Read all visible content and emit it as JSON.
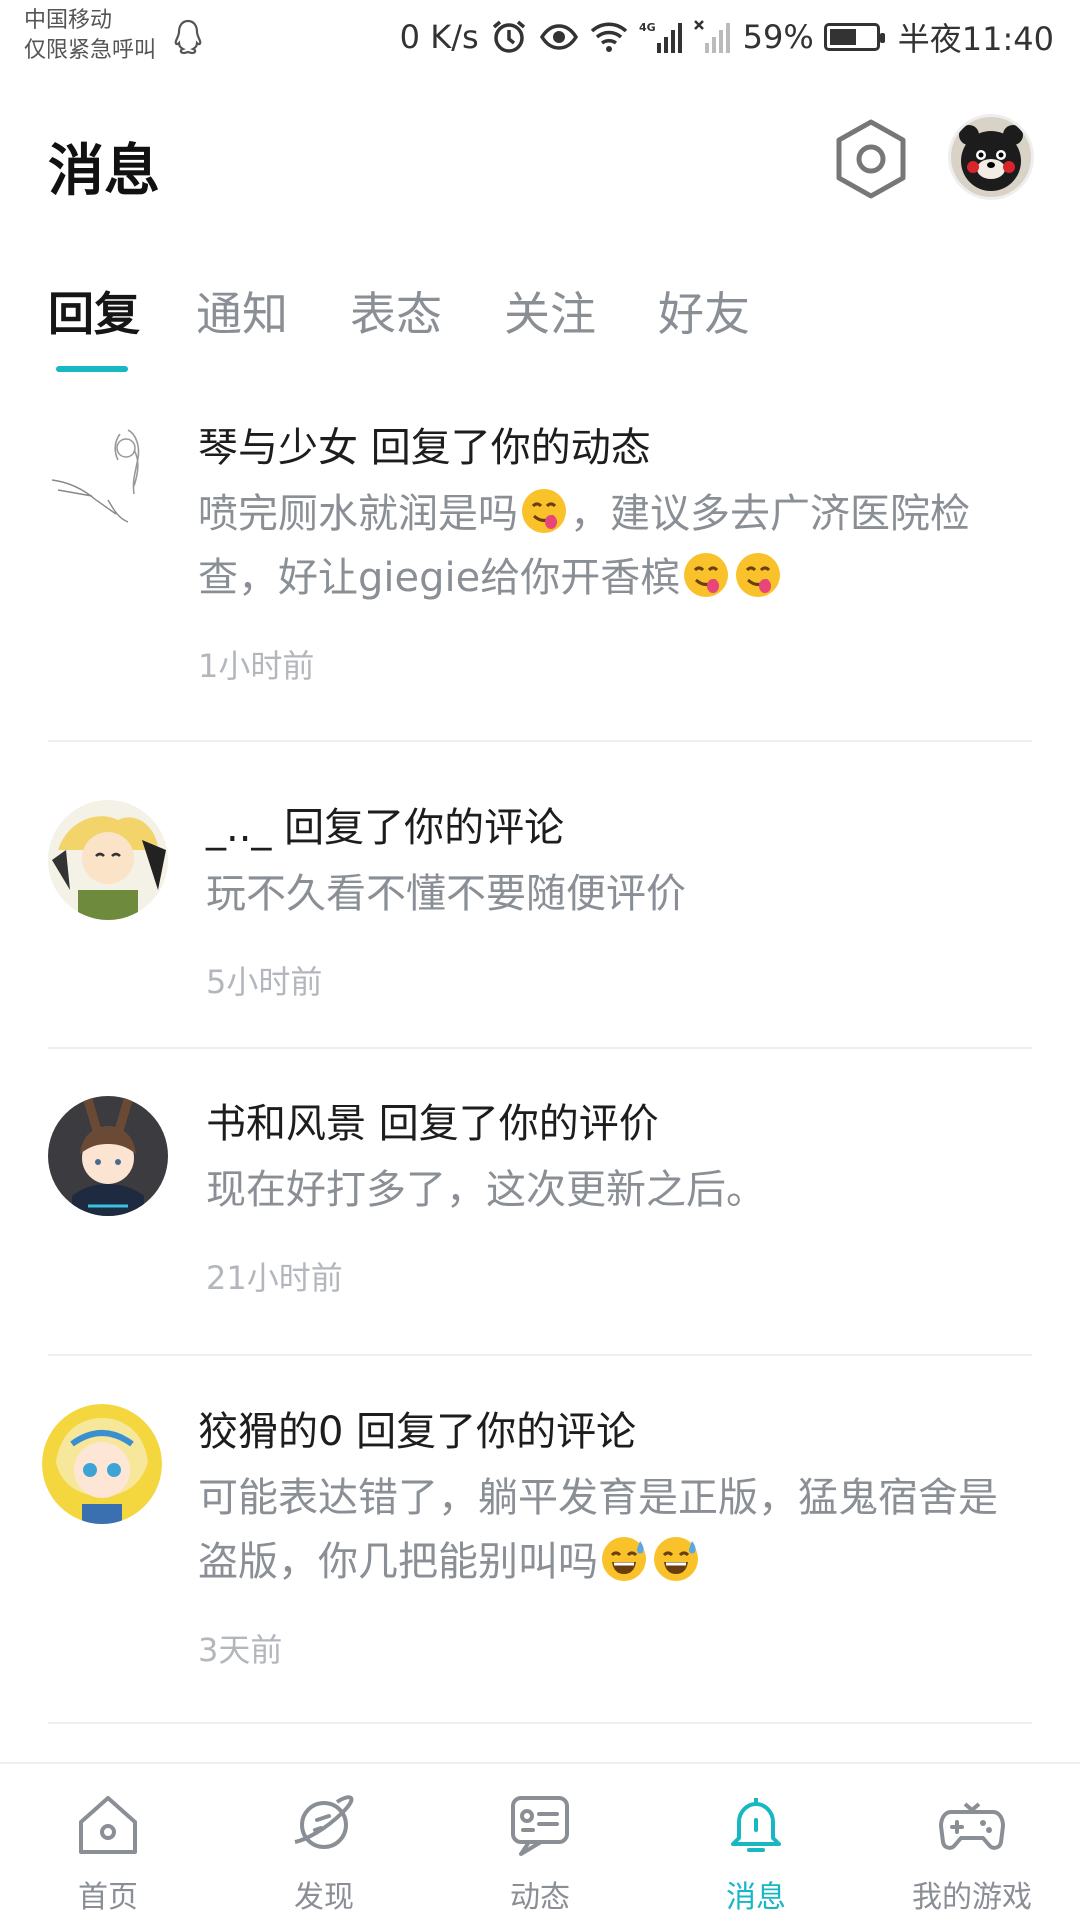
{
  "status_bar": {
    "carrier_line1": "中国移动",
    "carrier_line2": "仅限紧急呼叫",
    "net_speed": "0 K/s",
    "network": "4G",
    "battery_percent": "59%",
    "battery_level": 0.59,
    "time": "半夜11:40",
    "icons": [
      "qq-icon",
      "alarm-icon",
      "eye-icon",
      "wifi-icon",
      "signal-icon",
      "no-signal-icon",
      "battery-icon"
    ]
  },
  "header": {
    "title": "消息",
    "settings_icon": "hexagon-gear-icon",
    "avatar_icon": "kumamon-avatar"
  },
  "tabs": [
    {
      "label": "回复",
      "active": true
    },
    {
      "label": "通知",
      "active": false
    },
    {
      "label": "表态",
      "active": false
    },
    {
      "label": "关注",
      "active": false
    },
    {
      "label": "好友",
      "active": false
    }
  ],
  "accent_color": "#17b8c3",
  "messages": [
    {
      "user": "琴与少女",
      "action": "回复了你的动态",
      "text_parts": [
        "喷完厕水就润是吗",
        "，建议多去广济医院检查，好让giegie给你开香槟"
      ],
      "emoji": "savoring-face-emoji",
      "time": "1小时前"
    },
    {
      "user": "_.._",
      "action": "回复了你的评论",
      "text_parts": [
        "玩不久看不懂不要随便评价"
      ],
      "time": "5小时前"
    },
    {
      "user": "书和风景",
      "action": "回复了你的评价",
      "text_parts": [
        "现在好打多了，这次更新之后。"
      ],
      "time": "21小时前"
    },
    {
      "user": "狡猾的0",
      "action": "回复了你的评论",
      "text_parts": [
        "可能表达错了，躺平发育是正版，猛鬼宿舍是盗版，你几把能别叫吗"
      ],
      "emoji": "sweat-smile-emoji",
      "time": "3天前"
    }
  ],
  "bottom_nav": [
    {
      "label": "首页",
      "icon": "home-icon",
      "active": false
    },
    {
      "label": "发现",
      "icon": "planet-icon",
      "active": false
    },
    {
      "label": "动态",
      "icon": "feed-icon",
      "active": false
    },
    {
      "label": "消息",
      "icon": "bell-icon",
      "active": true
    },
    {
      "label": "我的游戏",
      "icon": "gamepad-icon",
      "active": false
    }
  ]
}
